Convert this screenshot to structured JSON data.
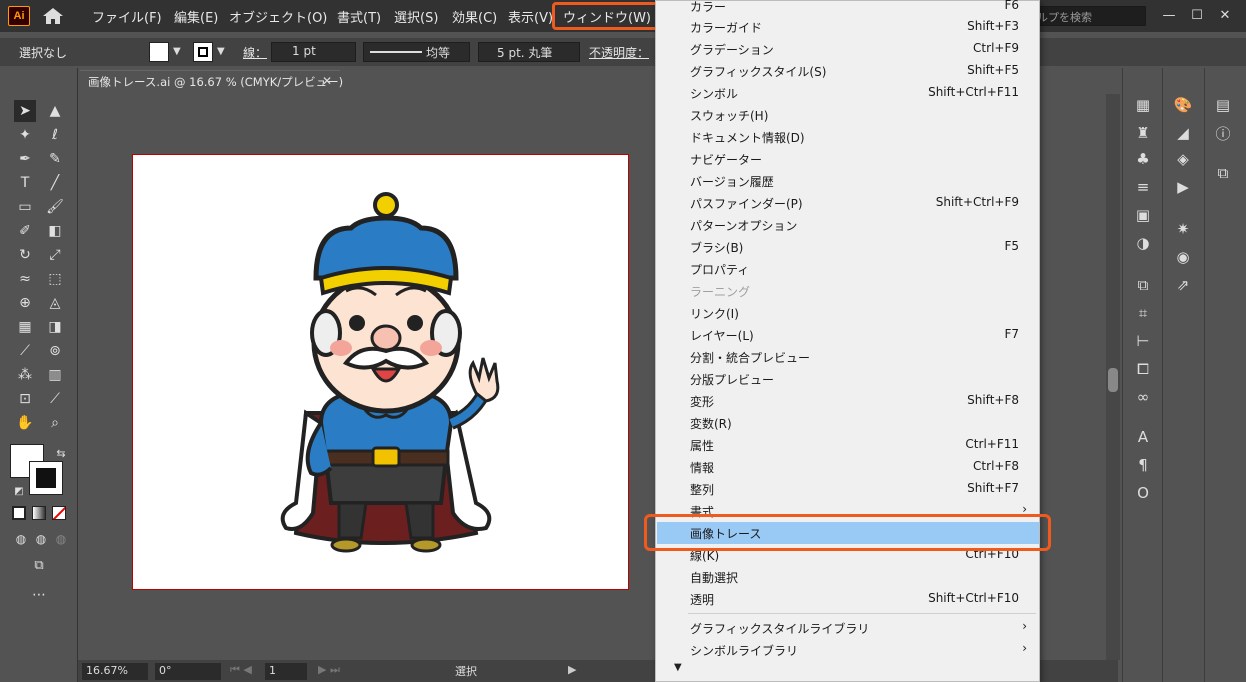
{
  "app": {
    "logo": "Ai",
    "file_tab": "画像トレース.ai @ 16.67 % (CMYK/プレビュー)"
  },
  "menubar": {
    "items": [
      "ファイル(F)",
      "編集(E)",
      "オブジェクト(O)",
      "書式(T)",
      "選択(S)",
      "効果(C)",
      "表示(V)",
      "ウィンドウ(W)"
    ],
    "search_placeholder": "ルプを検索",
    "highlight_color": "#ef5a1f"
  },
  "controlbar": {
    "selection": "選択なし",
    "stroke_label": "線：",
    "stroke_weight": "1 pt",
    "line_style": "均等",
    "brush": "5 pt. 丸筆",
    "opacity_label": "不透明度："
  },
  "statusbar": {
    "zoom": "16.67%",
    "rotation": "0°",
    "artboard": "1",
    "mode": "選択"
  },
  "window_menu": {
    "items": [
      {
        "label": "カラー",
        "shortcut": "F6"
      },
      {
        "label": "カラーガイド",
        "shortcut": "Shift+F3"
      },
      {
        "label": "グラデーション",
        "shortcut": "Ctrl+F9"
      },
      {
        "label": "グラフィックスタイル(S)",
        "shortcut": "Shift+F5"
      },
      {
        "label": "シンボル",
        "shortcut": "Shift+Ctrl+F11"
      },
      {
        "label": "スウォッチ(H)",
        "shortcut": ""
      },
      {
        "label": "ドキュメント情報(D)",
        "shortcut": ""
      },
      {
        "label": "ナビゲーター",
        "shortcut": ""
      },
      {
        "label": "バージョン履歴",
        "shortcut": ""
      },
      {
        "label": "パスファインダー(P)",
        "shortcut": "Shift+Ctrl+F9"
      },
      {
        "label": "パターンオプション",
        "shortcut": ""
      },
      {
        "label": "ブラシ(B)",
        "shortcut": "F5"
      },
      {
        "label": "プロパティ",
        "shortcut": ""
      },
      {
        "label": "ラーニング",
        "shortcut": "",
        "disabled": true
      },
      {
        "label": "リンク(I)",
        "shortcut": ""
      },
      {
        "label": "レイヤー(L)",
        "shortcut": "F7"
      },
      {
        "label": "分割・統合プレビュー",
        "shortcut": ""
      },
      {
        "label": "分版プレビュー",
        "shortcut": ""
      },
      {
        "label": "変形",
        "shortcut": "Shift+F8"
      },
      {
        "label": "変数(R)",
        "shortcut": ""
      },
      {
        "label": "属性",
        "shortcut": "Ctrl+F11"
      },
      {
        "label": "情報",
        "shortcut": "Ctrl+F8"
      },
      {
        "label": "整列",
        "shortcut": "Shift+F7"
      },
      {
        "label": "書式",
        "shortcut": "",
        "submenu": true
      },
      {
        "label": "画像トレース",
        "shortcut": "",
        "selected": true
      },
      {
        "label": "線(K)",
        "shortcut": "Ctrl+F10"
      },
      {
        "label": "自動選択",
        "shortcut": ""
      },
      {
        "label": "透明",
        "shortcut": "Shift+Ctrl+F10"
      }
    ],
    "library_items": [
      {
        "label": "グラフィックスタイルライブラリ",
        "submenu": true
      },
      {
        "label": "シンボルライブラリ",
        "submenu": true
      }
    ]
  }
}
